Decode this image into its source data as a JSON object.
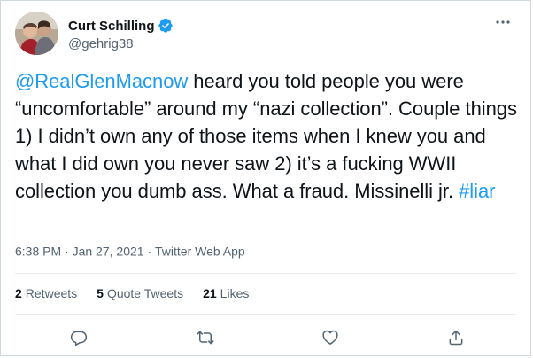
{
  "tweet": {
    "author": {
      "display_name": "Curt Schilling",
      "handle": "@gehrig38",
      "verified": true
    },
    "text": {
      "mention": "@RealGlenMacnow",
      "body": " heard you told people you were “uncomfortable” around my “nazi collection”. Couple things 1) I didn’t own any of those items when I knew you and what I did own you never saw 2) it’s a fucking WWII collection you dumb ass. What a fraud. Missinelli jr. ",
      "hashtag": "#liar"
    },
    "meta": {
      "time": "6:38 PM",
      "separator": "·",
      "date": "Jan 27, 2021",
      "source": "Twitter Web App"
    },
    "stats": {
      "retweets_count": "2",
      "retweets_label": "Retweets",
      "quotes_count": "5",
      "quotes_label": "Quote Tweets",
      "likes_count": "21",
      "likes_label": "Likes"
    },
    "actions": [
      "reply-icon",
      "retweet-icon",
      "like-icon",
      "share-icon"
    ]
  },
  "colors": {
    "accent": "#1d9bf0",
    "text": "#0f1419",
    "muted": "#536471",
    "border": "#cfd9de"
  }
}
